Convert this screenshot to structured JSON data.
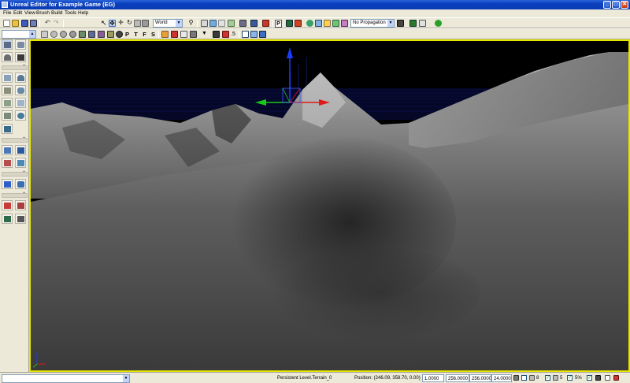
{
  "window": {
    "title": "Unreal Editor for Example Game (EG)",
    "minimize_glyph": "_",
    "maximize_glyph": "□",
    "close_glyph": "✕"
  },
  "menu": [
    "File",
    "Edit",
    "View",
    "Brush",
    "Build",
    "Tools",
    "Help"
  ],
  "toolbar": {
    "coordinate_system": "World",
    "propagation": "No Propagation",
    "view_letters": [
      "P",
      "T",
      "F",
      "S"
    ],
    "p_toggle": "P",
    "ruler_value": ".5"
  },
  "status": {
    "level": "Persistent Level.Terrain_0",
    "position": "Position: (246.09, 358.70, 0.00)",
    "drag_scale": "1.0000",
    "grid_x": "256.0000",
    "grid_y": "256.0000",
    "grid_z": "24.0000",
    "grid_snap": "8",
    "rotation_snap": "5",
    "scale_snap": "5%"
  },
  "icon_names": [
    "select-arrow-icon",
    "translate-icon",
    "rotate-icon",
    "scale-icon",
    "camera-mode-icon",
    "cube-builder-icon",
    "terrain-icon",
    "transform-widget-icon"
  ]
}
